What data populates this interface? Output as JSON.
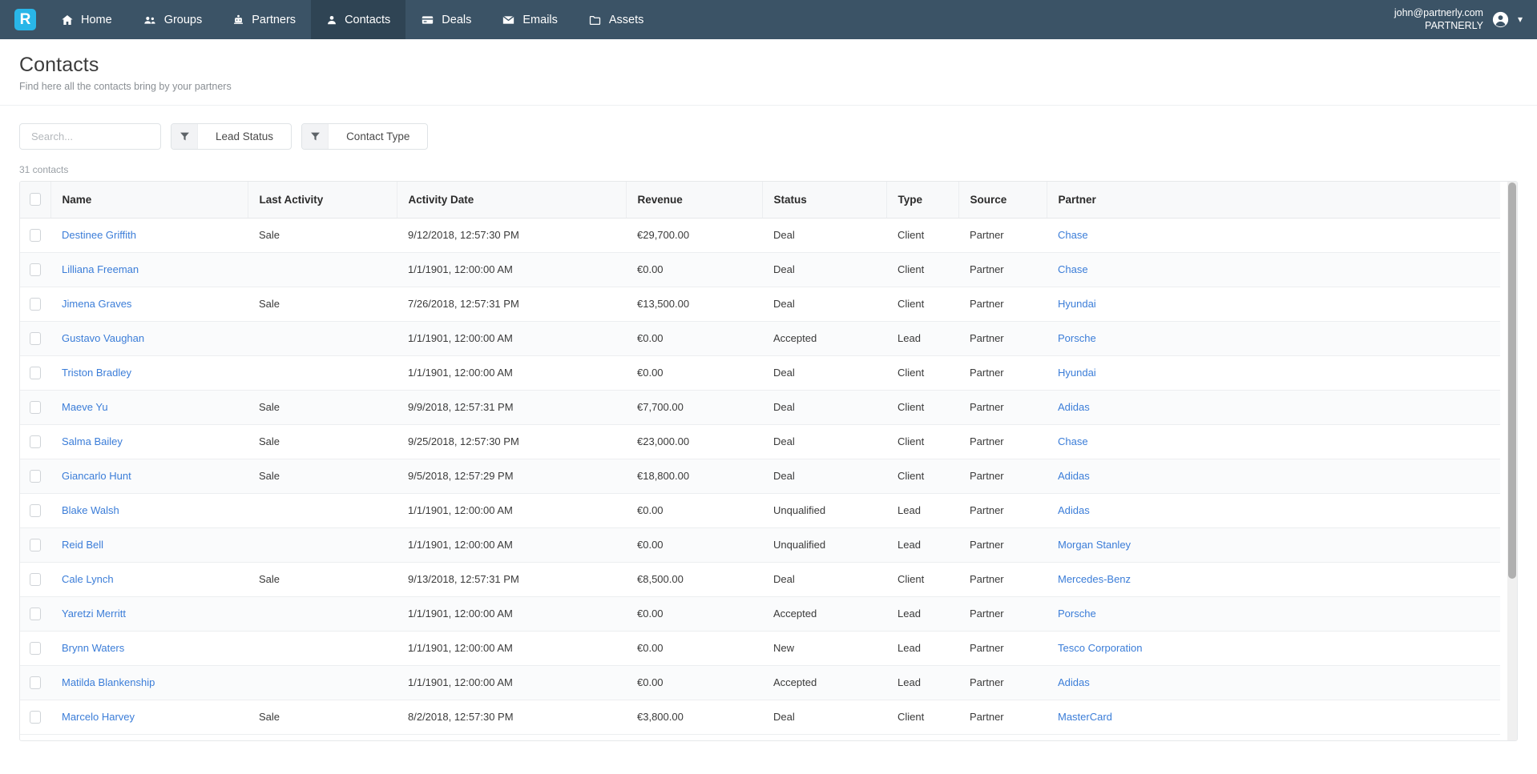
{
  "navbar": {
    "brand_letter": "R",
    "items": [
      {
        "label": "Home",
        "icon": "home-icon",
        "active": false
      },
      {
        "label": "Groups",
        "icon": "groups-icon",
        "active": false
      },
      {
        "label": "Partners",
        "icon": "partners-icon",
        "active": false
      },
      {
        "label": "Contacts",
        "icon": "contacts-icon",
        "active": true
      },
      {
        "label": "Deals",
        "icon": "deals-icon",
        "active": false
      },
      {
        "label": "Emails",
        "icon": "emails-icon",
        "active": false
      },
      {
        "label": "Assets",
        "icon": "assets-icon",
        "active": false
      }
    ],
    "user": {
      "email": "john@partnerly.com",
      "org": "PARTNERLY",
      "avatar_icon": "user-avatar-icon",
      "caret_icon": "chevron-down-icon"
    },
    "colors": {
      "bg": "#3b5366",
      "active_bg": "#2f4454",
      "brand_bg": "#29b6e8"
    }
  },
  "page": {
    "title": "Contacts",
    "subtitle": "Find here all the contacts bring by your partners"
  },
  "filters": {
    "search": {
      "value": "",
      "placeholder": "Search...",
      "icon": "search-icon"
    },
    "buttons": [
      {
        "label": "Lead Status",
        "icon": "funnel-icon"
      },
      {
        "label": "Contact Type",
        "icon": "funnel-icon"
      }
    ]
  },
  "table": {
    "count_label": "31 contacts",
    "columns": [
      "Name",
      "Last Activity",
      "Activity Date",
      "Revenue",
      "Status",
      "Type",
      "Source",
      "Partner"
    ],
    "rows": [
      {
        "name": "Destinee Griffith",
        "last_activity": "Sale",
        "activity_date": "9/12/2018, 12:57:30 PM",
        "revenue": "€29,700.00",
        "status": "Deal",
        "type": "Client",
        "source": "Partner",
        "partner": "Chase"
      },
      {
        "name": "Lilliana Freeman",
        "last_activity": "",
        "activity_date": "1/1/1901, 12:00:00 AM",
        "revenue": "€0.00",
        "status": "Deal",
        "type": "Client",
        "source": "Partner",
        "partner": "Chase"
      },
      {
        "name": "Jimena Graves",
        "last_activity": "Sale",
        "activity_date": "7/26/2018, 12:57:31 PM",
        "revenue": "€13,500.00",
        "status": "Deal",
        "type": "Client",
        "source": "Partner",
        "partner": "Hyundai"
      },
      {
        "name": "Gustavo Vaughan",
        "last_activity": "",
        "activity_date": "1/1/1901, 12:00:00 AM",
        "revenue": "€0.00",
        "status": "Accepted",
        "type": "Lead",
        "source": "Partner",
        "partner": "Porsche"
      },
      {
        "name": "Triston Bradley",
        "last_activity": "",
        "activity_date": "1/1/1901, 12:00:00 AM",
        "revenue": "€0.00",
        "status": "Deal",
        "type": "Client",
        "source": "Partner",
        "partner": "Hyundai"
      },
      {
        "name": "Maeve Yu",
        "last_activity": "Sale",
        "activity_date": "9/9/2018, 12:57:31 PM",
        "revenue": "€7,700.00",
        "status": "Deal",
        "type": "Client",
        "source": "Partner",
        "partner": "Adidas"
      },
      {
        "name": "Salma Bailey",
        "last_activity": "Sale",
        "activity_date": "9/25/2018, 12:57:30 PM",
        "revenue": "€23,000.00",
        "status": "Deal",
        "type": "Client",
        "source": "Partner",
        "partner": "Chase"
      },
      {
        "name": "Giancarlo Hunt",
        "last_activity": "Sale",
        "activity_date": "9/5/2018, 12:57:29 PM",
        "revenue": "€18,800.00",
        "status": "Deal",
        "type": "Client",
        "source": "Partner",
        "partner": "Adidas"
      },
      {
        "name": "Blake Walsh",
        "last_activity": "",
        "activity_date": "1/1/1901, 12:00:00 AM",
        "revenue": "€0.00",
        "status": "Unqualified",
        "type": "Lead",
        "source": "Partner",
        "partner": "Adidas"
      },
      {
        "name": "Reid Bell",
        "last_activity": "",
        "activity_date": "1/1/1901, 12:00:00 AM",
        "revenue": "€0.00",
        "status": "Unqualified",
        "type": "Lead",
        "source": "Partner",
        "partner": "Morgan Stanley"
      },
      {
        "name": "Cale Lynch",
        "last_activity": "Sale",
        "activity_date": "9/13/2018, 12:57:31 PM",
        "revenue": "€8,500.00",
        "status": "Deal",
        "type": "Client",
        "source": "Partner",
        "partner": "Mercedes-Benz"
      },
      {
        "name": "Yaretzi Merritt",
        "last_activity": "",
        "activity_date": "1/1/1901, 12:00:00 AM",
        "revenue": "€0.00",
        "status": "Accepted",
        "type": "Lead",
        "source": "Partner",
        "partner": "Porsche"
      },
      {
        "name": "Brynn Waters",
        "last_activity": "",
        "activity_date": "1/1/1901, 12:00:00 AM",
        "revenue": "€0.00",
        "status": "New",
        "type": "Lead",
        "source": "Partner",
        "partner": "Tesco Corporation"
      },
      {
        "name": "Matilda Blankenship",
        "last_activity": "",
        "activity_date": "1/1/1901, 12:00:00 AM",
        "revenue": "€0.00",
        "status": "Accepted",
        "type": "Lead",
        "source": "Partner",
        "partner": "Adidas"
      },
      {
        "name": "Marcelo Harvey",
        "last_activity": "Sale",
        "activity_date": "8/2/2018, 12:57:30 PM",
        "revenue": "€3,800.00",
        "status": "Deal",
        "type": "Client",
        "source": "Partner",
        "partner": "MasterCard"
      }
    ]
  }
}
